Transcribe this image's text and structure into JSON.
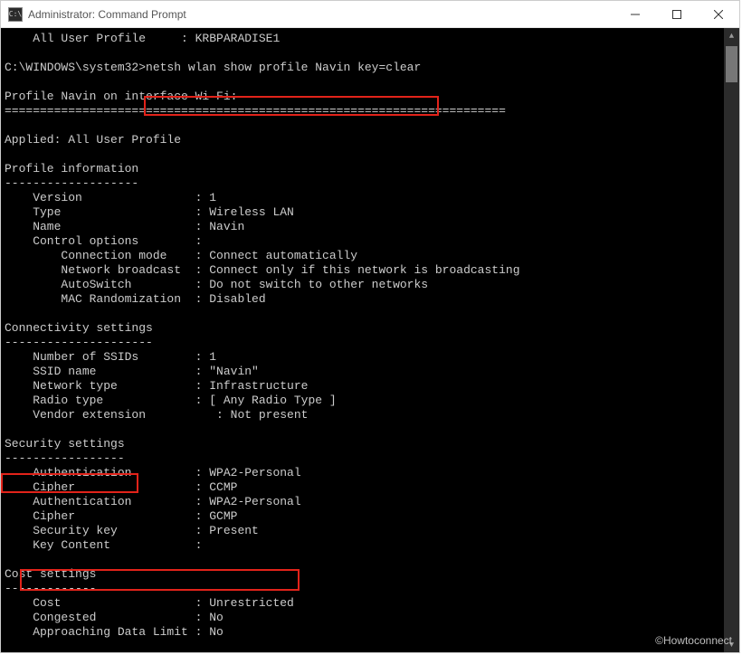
{
  "titlebar": {
    "icon_glyph": "C:\\",
    "title": "Administrator: Command Prompt"
  },
  "watermark": "©Howtoconnect",
  "lines": {
    "l0": "    All User Profile     : KRBPARADISE1",
    "l1": "",
    "l2": "C:\\WINDOWS\\system32>netsh wlan show profile Navin key=clear",
    "l3": "",
    "l4": "Profile Navin on interface Wi-Fi:",
    "l5": "=======================================================================",
    "l6": "",
    "l7": "Applied: All User Profile",
    "l8": "",
    "l9": "Profile information",
    "l10": "-------------------",
    "l11": "    Version                : 1",
    "l12": "    Type                   : Wireless LAN",
    "l13": "    Name                   : Navin",
    "l14": "    Control options        :",
    "l15": "        Connection mode    : Connect automatically",
    "l16": "        Network broadcast  : Connect only if this network is broadcasting",
    "l17": "        AutoSwitch         : Do not switch to other networks",
    "l18": "        MAC Randomization  : Disabled",
    "l19": "",
    "l20": "Connectivity settings",
    "l21": "---------------------",
    "l22": "    Number of SSIDs        : 1",
    "l23": "    SSID name              : \"Navin\"",
    "l24": "    Network type           : Infrastructure",
    "l25": "    Radio type             : [ Any Radio Type ]",
    "l26": "    Vendor extension          : Not present",
    "l27": "",
    "l28": "Security settings",
    "l29": "-----------------",
    "l30": "    Authentication         : WPA2-Personal",
    "l31": "    Cipher                 : CCMP",
    "l32": "    Authentication         : WPA2-Personal",
    "l33": "    Cipher                 : GCMP",
    "l34": "    Security key           : Present",
    "l35": "    Key Content            : ",
    "l36": "",
    "l37": "Cost settings",
    "l38": "-------------",
    "l39": "    Cost                   : Unrestricted",
    "l40": "    Congested              : No",
    "l41": "    Approaching Data Limit : No"
  }
}
